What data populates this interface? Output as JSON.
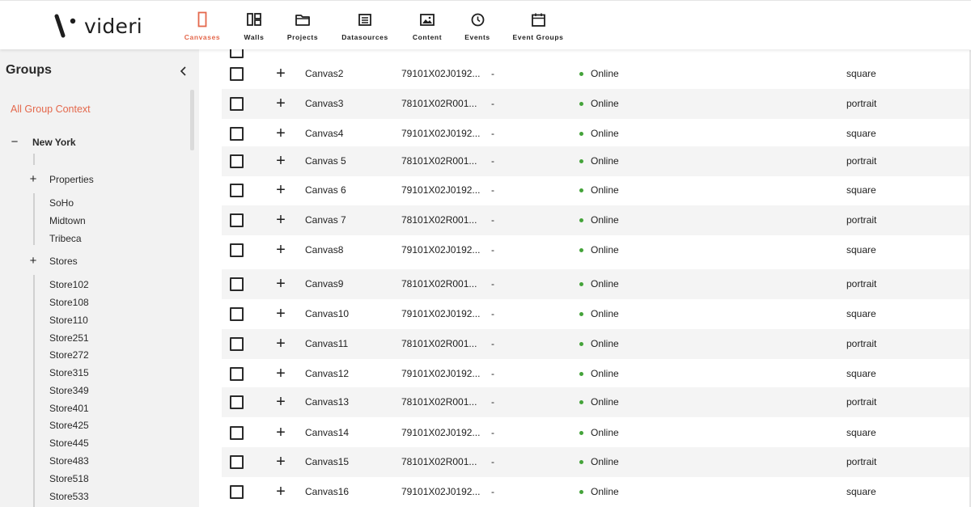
{
  "app": {
    "logo_text": "videri",
    "accent": "#e4684c",
    "status_color": "#44a33a"
  },
  "nav": [
    {
      "label": "Canvases",
      "icon": "canvas-icon",
      "active": true
    },
    {
      "label": "Walls",
      "icon": "walls-icon"
    },
    {
      "label": "Projects",
      "icon": "folder-icon"
    },
    {
      "label": "Datasources",
      "icon": "datasource-icon"
    },
    {
      "label": "Content",
      "icon": "image-icon"
    },
    {
      "label": "Events",
      "icon": "clock-icon"
    },
    {
      "label": "Event Groups",
      "icon": "calendar-icon"
    }
  ],
  "sidebar": {
    "title": "Groups",
    "context_link": "All Group Context",
    "root": {
      "label": "New York",
      "toggle": "−"
    },
    "properties": {
      "label": "Properties",
      "toggle": "+",
      "items": [
        "SoHo",
        "Midtown",
        "Tribeca"
      ]
    },
    "stores": {
      "label": "Stores",
      "toggle": "+",
      "items": [
        "Store102",
        "Store108",
        "Store110",
        "Store251",
        "Store272",
        "Store315",
        "Store349",
        "Store401",
        "Store425",
        "Store445",
        "Store483",
        "Store518",
        "Store533"
      ]
    }
  },
  "table": {
    "rows": [
      {
        "name": "Canvas2",
        "serial": "79101X02J0192...",
        "extra": "-",
        "status": "Online",
        "orientation": "square"
      },
      {
        "name": "Canvas3",
        "serial": "78101X02R001...",
        "extra": "-",
        "status": "Online",
        "orientation": "portrait"
      },
      {
        "name": "Canvas4",
        "serial": "79101X02J0192...",
        "extra": "-",
        "status": "Online",
        "orientation": "square"
      },
      {
        "name": "Canvas 5",
        "serial": "78101X02R001...",
        "extra": "-",
        "status": "Online",
        "orientation": "portrait"
      },
      {
        "name": "Canvas 6",
        "serial": "79101X02J0192...",
        "extra": "-",
        "status": "Online",
        "orientation": "square"
      },
      {
        "name": "Canvas 7",
        "serial": "78101X02R001...",
        "extra": "-",
        "status": "Online",
        "orientation": "portrait"
      },
      {
        "name": "Canvas8",
        "serial": "79101X02J0192...",
        "extra": "-",
        "status": "Online",
        "orientation": "square"
      },
      {
        "name": "Canvas9",
        "serial": "78101X02R001...",
        "extra": "-",
        "status": "Online",
        "orientation": "portrait"
      },
      {
        "name": "Canvas10",
        "serial": "79101X02J0192...",
        "extra": "-",
        "status": "Online",
        "orientation": "square"
      },
      {
        "name": "Canvas11",
        "serial": "78101X02R001...",
        "extra": "-",
        "status": "Online",
        "orientation": "portrait"
      },
      {
        "name": "Canvas12",
        "serial": "79101X02J0192...",
        "extra": "-",
        "status": "Online",
        "orientation": "square"
      },
      {
        "name": "Canvas13",
        "serial": "78101X02R001...",
        "extra": "-",
        "status": "Online",
        "orientation": "portrait"
      },
      {
        "name": "Canvas14",
        "serial": "79101X02J0192...",
        "extra": "-",
        "status": "Online",
        "orientation": "square"
      },
      {
        "name": "Canvas15",
        "serial": "78101X02R001...",
        "extra": "-",
        "status": "Online",
        "orientation": "portrait"
      },
      {
        "name": "Canvas16",
        "serial": "79101X02J0192...",
        "extra": "-",
        "status": "Online",
        "orientation": "square"
      }
    ]
  }
}
